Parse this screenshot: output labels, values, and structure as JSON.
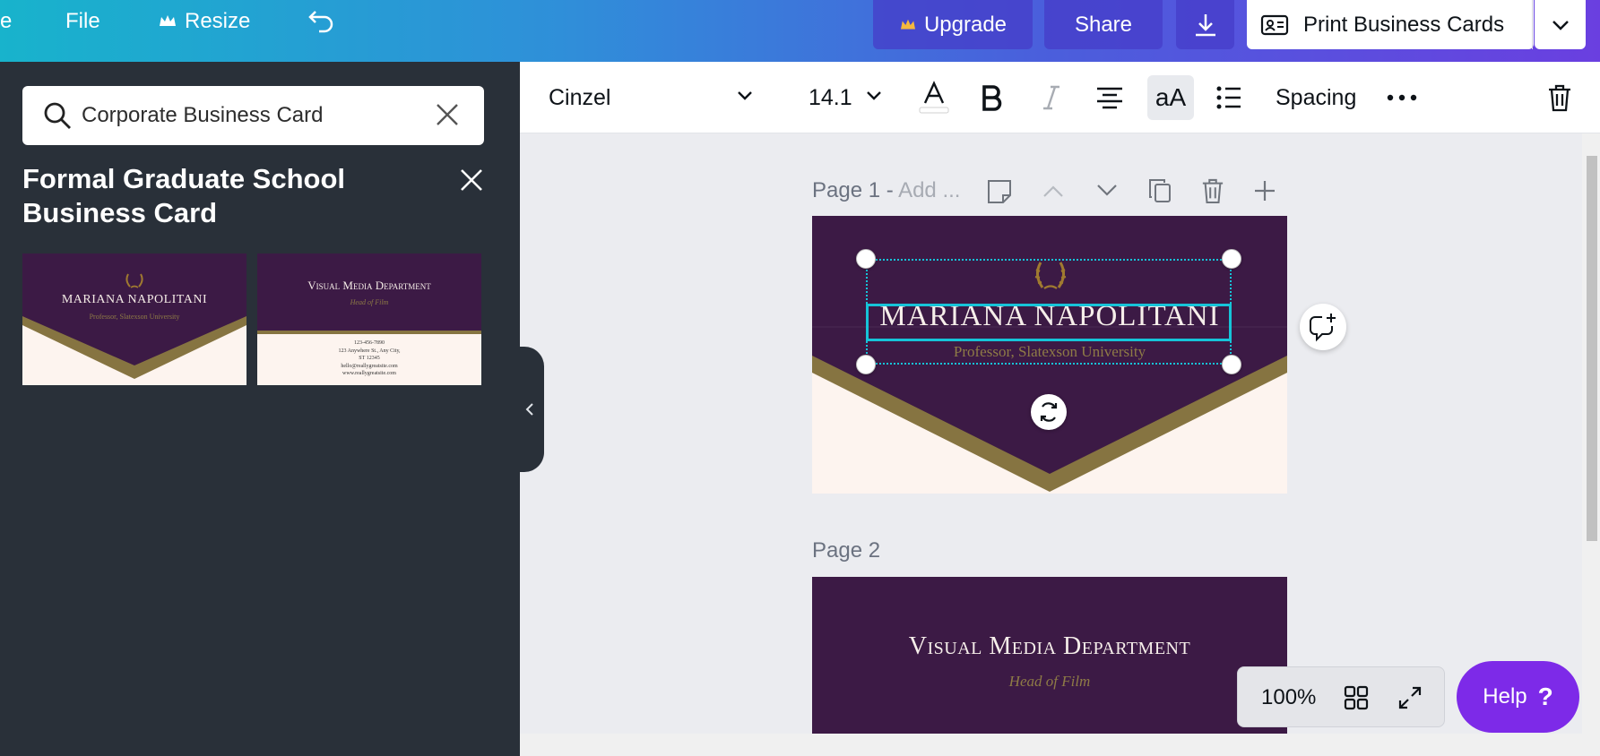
{
  "topbar": {
    "home_label": "e",
    "file_label": "File",
    "resize_label": "Resize",
    "upgrade_label": "Upgrade",
    "share_label": "Share",
    "print_label": "Print Business Cards"
  },
  "sidebar": {
    "search_value": "Corporate Business Card",
    "template_title": "Formal Graduate School Business Card",
    "thumb_front": {
      "name": "MARIANA NAPOLITANI",
      "subtitle": "Professor, Slatexson University"
    },
    "thumb_back": {
      "title": "Visual Media Department",
      "subtitle": "Head of Film",
      "contact_lines": [
        "123-456-7890",
        "123 Anywhere St., Any City,",
        "ST 12345",
        "hello@reallygreatsite.com",
        "www.reallygreatsite.com"
      ]
    }
  },
  "toolbar": {
    "font_name": "Cinzel",
    "font_size": "14.1",
    "spacing_label": "Spacing"
  },
  "canvas": {
    "page1_label": "Page 1 - ",
    "page1_placeholder": "Add ...",
    "page2_label": "Page 2",
    "card1": {
      "name": "MARIANA NAPOLITANI",
      "subtitle": "Professor, Slatexson University"
    },
    "card2": {
      "title": "Visual Media Department",
      "subtitle": "Head of Film"
    }
  },
  "footer": {
    "zoom_level": "100%",
    "help_label": "Help",
    "help_symbol": "?"
  },
  "colors": {
    "card_purple": "#3c1a45",
    "card_gold": "#867441",
    "card_cream": "#fdf4ef",
    "selection_cyan": "#16c4d8",
    "help_purple": "#7d2ae8"
  },
  "icons": [
    "crown-icon",
    "undo-icon",
    "download-icon",
    "card-icon",
    "chevron-down-icon",
    "search-icon",
    "close-icon",
    "text-color-icon",
    "bold-icon",
    "italic-icon",
    "align-center-icon",
    "case-icon",
    "list-icon",
    "more-icon",
    "trash-icon",
    "note-icon",
    "chevron-up-icon",
    "duplicate-icon",
    "plus-icon",
    "comment-add-icon",
    "rotate-icon",
    "grid-icon",
    "fullscreen-icon",
    "laurel-icon"
  ]
}
